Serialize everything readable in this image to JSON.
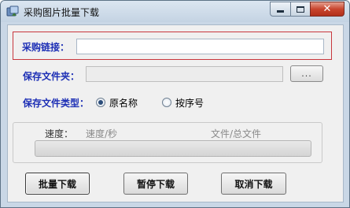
{
  "window": {
    "title": "采购图片批量下载",
    "icon": "app-icon",
    "controls": [
      "minimize-icon",
      "maximize-icon",
      "close-icon"
    ],
    "close_glyph": "✕"
  },
  "form": {
    "url_label": "采购链接：",
    "url_value": "",
    "folder_label": "保存文件夹：",
    "folder_value": "",
    "browse_label": "...",
    "type_label": "保存文件类型：",
    "type_options": [
      {
        "label": "原名称",
        "checked": true
      },
      {
        "label": "按序号",
        "checked": false
      }
    ]
  },
  "progress": {
    "speed_label": "速度：",
    "speed_value": "速度/秒",
    "files_value": "文件/总文件",
    "percent": 0
  },
  "buttons": {
    "batch_download": "批量下载",
    "pause_download": "暂停下载",
    "cancel_download": "取消下载"
  },
  "colors": {
    "label_blue": "#1d2fb5",
    "url_box_border": "#c8373d",
    "close_button": "#c8452e"
  }
}
